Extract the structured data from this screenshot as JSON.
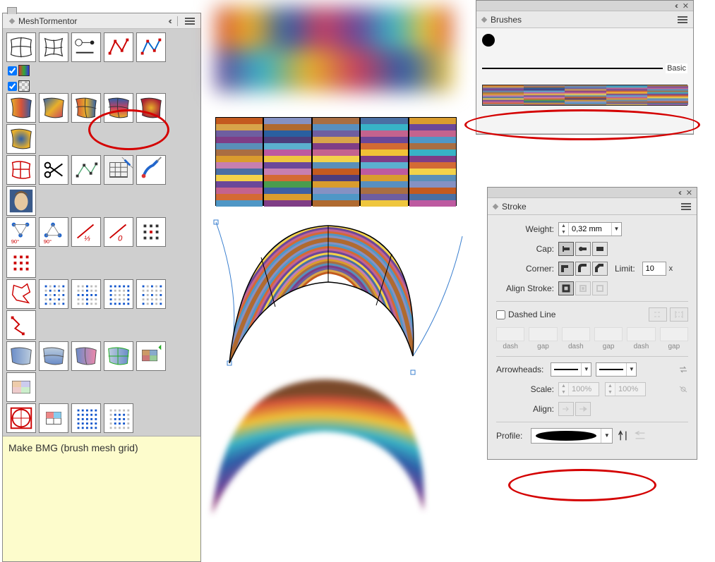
{
  "meshTormentor": {
    "title": "MeshTormentor",
    "tooltip": "Make BMG (brush mesh grid)",
    "checkboxes": {
      "color": true,
      "pattern": true
    }
  },
  "brushes": {
    "title": "Brushes",
    "items": {
      "basic_label": "Basic"
    }
  },
  "stroke": {
    "title": "Stroke",
    "weight_label": "Weight:",
    "weight_value": "0,32 mm",
    "cap_label": "Cap:",
    "corner_label": "Corner:",
    "limit_label": "Limit:",
    "limit_value": "10",
    "limit_unit": "x",
    "align_label": "Align Stroke:",
    "dashed_label": "Dashed Line",
    "dashed_checked": false,
    "dash_labels": [
      "dash",
      "gap",
      "dash",
      "gap",
      "dash",
      "gap"
    ],
    "arrowheads_label": "Arrowheads:",
    "scale_label": "Scale:",
    "scale_value_a": "100%",
    "scale_value_b": "100%",
    "align_arrow_label": "Align:",
    "profile_label": "Profile:"
  },
  "palette": {
    "columns": [
      [
        "#c45a1f",
        "#d8a44a",
        "#6e5ea0",
        "#7f3d86",
        "#5a8fb8",
        "#a96e42",
        "#d99c2e",
        "#c77fb0",
        "#4a6fa3",
        "#f3d24a",
        "#6b4799",
        "#c4638e",
        "#d46a34",
        "#4f97c6"
      ],
      [
        "#8591c3",
        "#b06a30",
        "#2a5fa0",
        "#4c3d7c",
        "#5bb0cf",
        "#bd5aa0",
        "#efc63e",
        "#6b4799",
        "#c77fb0",
        "#d46a34",
        "#4a9c4e",
        "#3c5fa3",
        "#d99c2e",
        "#7f3d86"
      ],
      [
        "#a96e42",
        "#588fbf",
        "#6e5ea0",
        "#d8a44a",
        "#7f3d86",
        "#c4638e",
        "#f3d24a",
        "#5a8fb8",
        "#c45a1f",
        "#4c3d7c",
        "#d99c2e",
        "#8591c3",
        "#4f97c6",
        "#b06a30"
      ],
      [
        "#4a6fa3",
        "#38b3c6",
        "#c4638e",
        "#6b4799",
        "#d46a34",
        "#f0c236",
        "#7f3d86",
        "#5bb0cf",
        "#bd5aa0",
        "#d99c2e",
        "#588fbf",
        "#a96e42",
        "#6e5ea0",
        "#efc63e"
      ],
      [
        "#d99c2e",
        "#6b4799",
        "#c4638e",
        "#4f97c6",
        "#a96e42",
        "#38b3c6",
        "#7f3d86",
        "#d46a34",
        "#f3d24a",
        "#5a8fb8",
        "#8591c3",
        "#c45a1f",
        "#4a6fa3",
        "#bd5aa0"
      ]
    ]
  }
}
